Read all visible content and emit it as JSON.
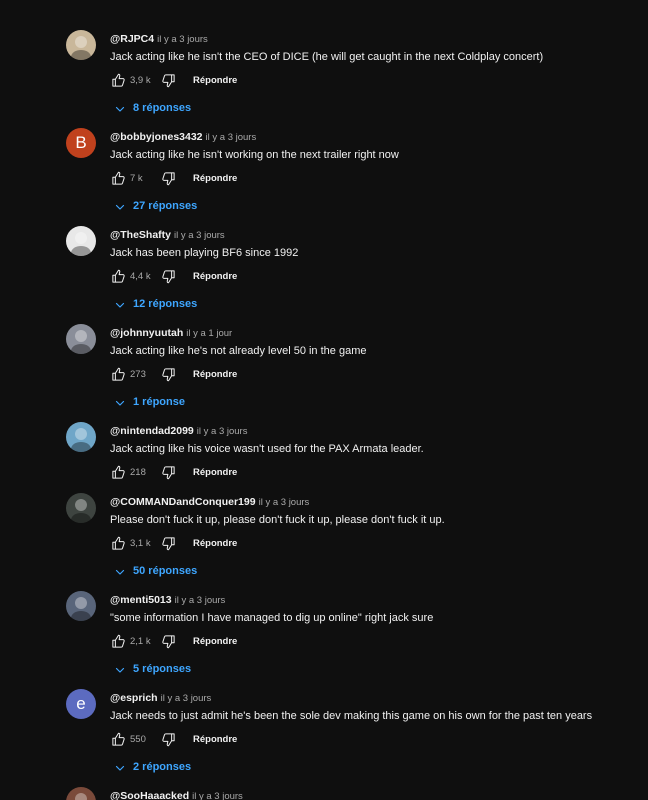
{
  "action_labels": {
    "reply": "Répondre"
  },
  "comments": [
    {
      "author": "@RJPC4",
      "time": "il y a 3 jours",
      "text": "Jack acting like he isn't the CEO of DICE (he will get caught in the next Coldplay concert)",
      "likes": "3,9 k",
      "replies": "8 réponses",
      "avatar": {
        "kind": "image",
        "color": "#c9b79a",
        "letter": ""
      }
    },
    {
      "author": "@bobbyjones3432",
      "time": "il y a 3 jours",
      "text": "Jack acting like he isn't working on the next trailer right now",
      "likes": "7 k",
      "replies": "27 réponses",
      "avatar": {
        "kind": "letter",
        "color": "#c0411d",
        "letter": "B"
      }
    },
    {
      "author": "@TheShafty",
      "time": "il y a 3 jours",
      "text": "Jack has been playing BF6 since 1992",
      "likes": "4,4 k",
      "replies": "12 réponses",
      "avatar": {
        "kind": "image",
        "color": "#e8e8e8",
        "letter": ""
      }
    },
    {
      "author": "@johnnyuutah",
      "time": "il y a 1 jour",
      "text": "Jack acting like he's not already level 50 in the game",
      "likes": "273",
      "replies": "1 réponse",
      "avatar": {
        "kind": "image",
        "color": "#8a8e99",
        "letter": ""
      }
    },
    {
      "author": "@nintendad2099",
      "time": "il y a 3 jours",
      "text": "Jack acting like his voice wasn't used for the PAX Armata leader.",
      "likes": "218",
      "replies": "",
      "avatar": {
        "kind": "image",
        "color": "#6fa6c8",
        "letter": ""
      }
    },
    {
      "author": "@COMMANDandConquer199",
      "time": "il y a 3 jours",
      "text": "Please don't fuck it up, please don't fuck it up, please don't fuck it up.",
      "likes": "3,1 k",
      "replies": "50 réponses",
      "avatar": {
        "kind": "image",
        "color": "#3e4440",
        "letter": ""
      }
    },
    {
      "author": "@menti5013",
      "time": "il y a 3 jours",
      "text": "\"some information I have managed to dig up online\" right jack sure",
      "likes": "2,1 k",
      "replies": "5 réponses",
      "avatar": {
        "kind": "image",
        "color": "#59657a",
        "letter": ""
      }
    },
    {
      "author": "@esprich",
      "time": "il y a 3 jours",
      "text": "Jack needs to just admit he's been the sole dev making this game on his own for the past ten years",
      "likes": "550",
      "replies": "2 réponses",
      "avatar": {
        "kind": "letter",
        "color": "#5c6bc0",
        "letter": "e"
      }
    },
    {
      "author": "@SooHaaacked",
      "time": "il y a 3 jours",
      "text": "",
      "likes": "",
      "replies": "",
      "avatar": {
        "kind": "image",
        "color": "#7a4a3a",
        "letter": ""
      }
    }
  ]
}
